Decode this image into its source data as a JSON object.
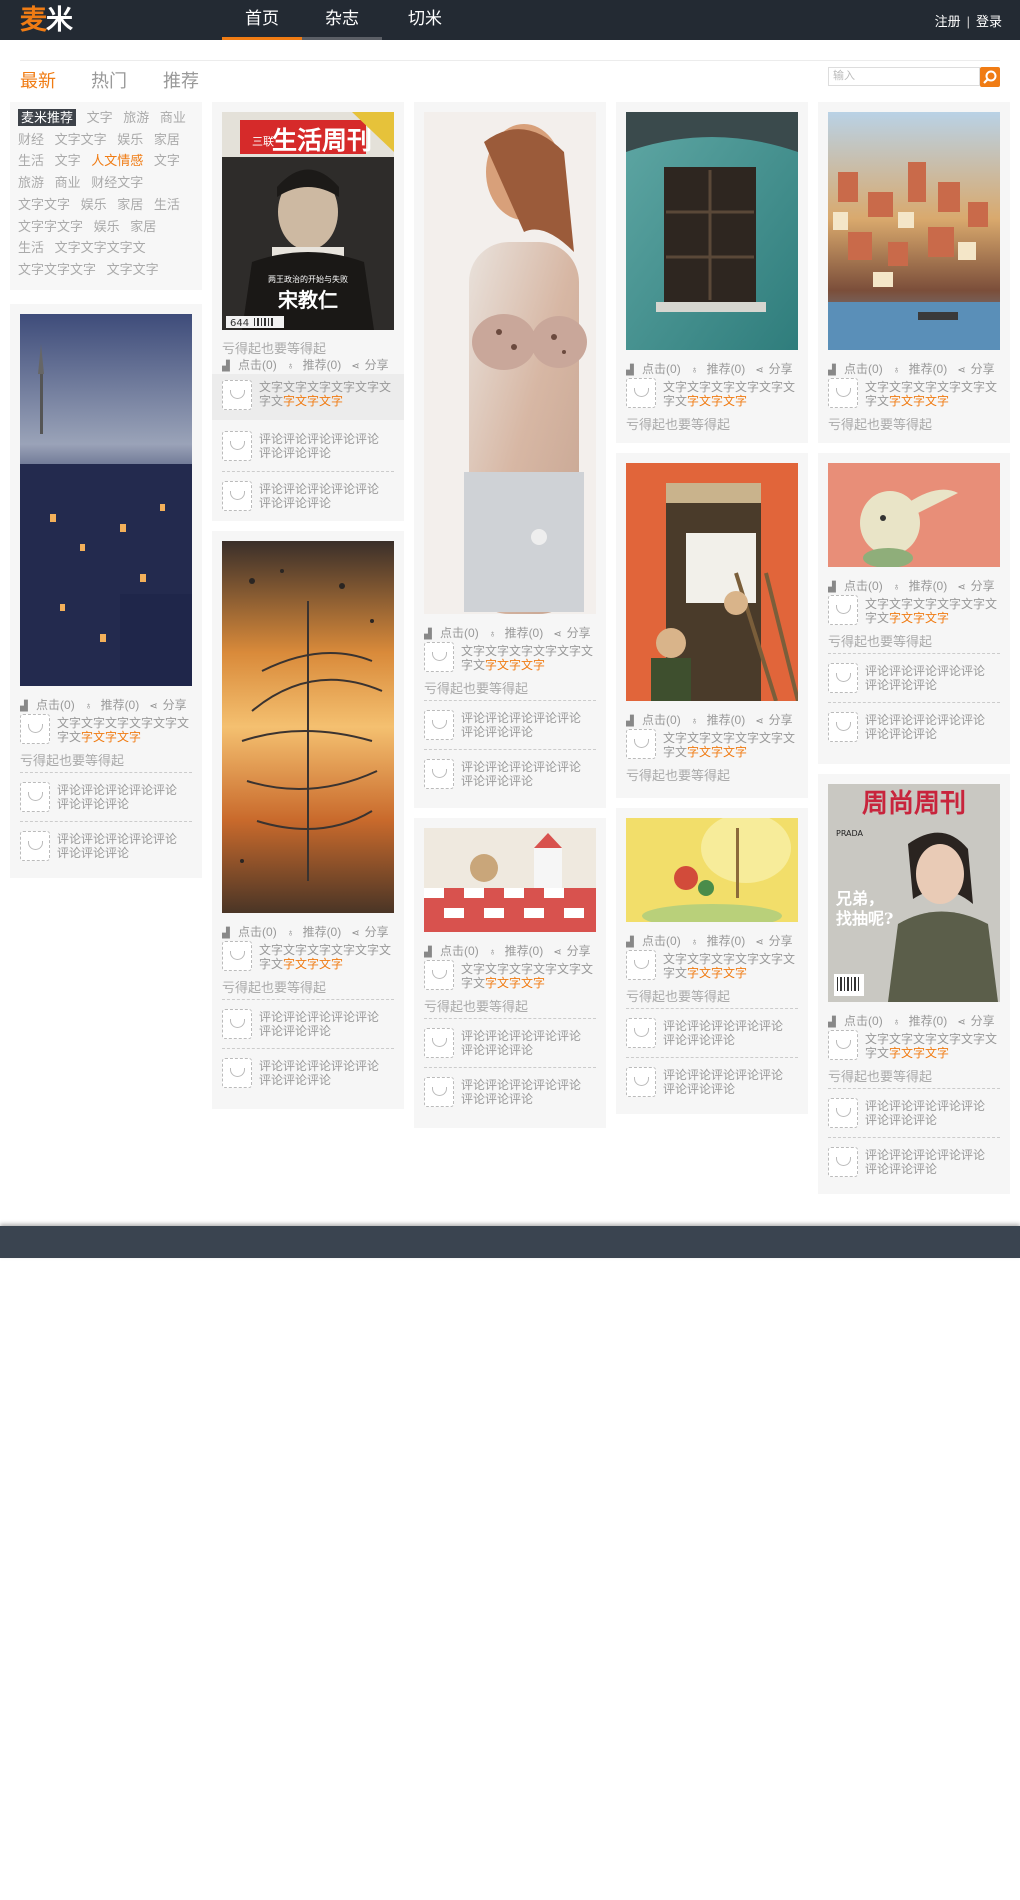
{
  "nav": {
    "logo_1": "麦",
    "logo_2": "米",
    "tabs": [
      "首页",
      "杂志",
      "切米"
    ],
    "register": "注册",
    "divider": "|",
    "login": "登录"
  },
  "subnav": {
    "tabs": [
      "最新",
      "热门",
      "推荐"
    ],
    "search_placeholder": "输入"
  },
  "tags": [
    "麦米推荐",
    "文字",
    "旅游",
    "商业",
    "财经",
    "文字文字",
    "娱乐",
    "家居",
    "生活",
    "文字",
    "人文情感",
    "文字",
    "旅游",
    "商业",
    "财经文字",
    "文字文字",
    "娱乐",
    "家居",
    "生活",
    "文字字文字",
    "娱乐",
    "家居",
    "生活",
    "文字文字文字文",
    "文字文字文字",
    "文字文字"
  ],
  "tag_states": {
    "selected": "麦米推荐",
    "highlighted": "人文情感"
  },
  "card_text": {
    "clicks": "点击(0)",
    "recommend": "推荐(0)",
    "share": "分享",
    "desc": "文字文字文字文字文字文字文",
    "desc_hl": "字文字文字",
    "caption": "亏得起也要等得起",
    "comment": "评论评论评论评论评论评论评论评论"
  },
  "magazine_1": {
    "title_left": "三联",
    "title": "生活周刊",
    "subtitle": "两王政治的开始与失败",
    "cover_name": "宋教仁",
    "issue": "644"
  },
  "magazine_2": {
    "title": "周尚周刊",
    "brand": "PRADA",
    "headline_1": "兄弟，",
    "headline_2": "找抽呢?"
  },
  "colors": {
    "accent": "#f07c14",
    "topbar": "#232a33",
    "footer": "#3a4450",
    "card_bg": "#f6f6f6"
  },
  "icons": [
    "search-icon",
    "bar-chart-icon",
    "thumb-icon",
    "share-icon",
    "smiley-avatar-icon"
  ]
}
